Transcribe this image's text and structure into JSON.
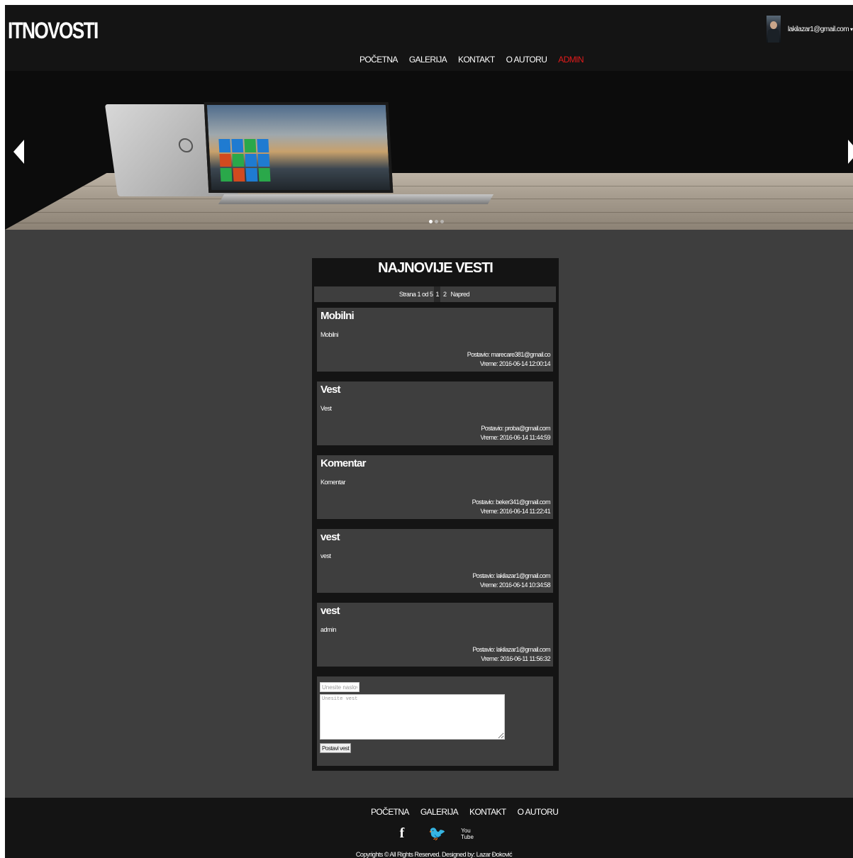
{
  "header": {
    "logo": "ITNOVOSTI",
    "user_email": "lakilazar1@gmail.com",
    "user_caret": "▾",
    "nav": [
      {
        "label": "POČETNA"
      },
      {
        "label": "GALERIJA"
      },
      {
        "label": "KONTAKT"
      },
      {
        "label": "O AUTORU"
      },
      {
        "label": "ADMIN"
      }
    ]
  },
  "slider": {
    "active_slide": 1,
    "slide_count": 3
  },
  "news": {
    "title": "NAJNOVIJE VESTI",
    "pager": {
      "text": "Strana 1 od 5",
      "pages": [
        "1",
        "2"
      ],
      "next": "Napred"
    },
    "articles": [
      {
        "title": "Mobilni",
        "body": "Mobilni",
        "author": "Postavio: marecare381@gmail.co",
        "time": "Vreme: 2016-06-14 12:00:14"
      },
      {
        "title": "Vest",
        "body": "Vest",
        "author": "Postavio: proba@gmail.com",
        "time": "Vreme: 2016-06-14 11:44:59"
      },
      {
        "title": "Komentar",
        "body": "Komentar",
        "author": "Postavio: beker341@gmail.com",
        "time": "Vreme: 2016-06-14 11:22:41"
      },
      {
        "title": "vest",
        "body": "vest",
        "author": "Postavio: lakilazar1@gmail.com",
        "time": "Vreme: 2016-06-14 10:34:58"
      },
      {
        "title": "vest",
        "body": "admin",
        "author": "Postavio: lakilazar1@gmail.com",
        "time": "Vreme: 2016-06-11 11:56:32"
      }
    ],
    "form": {
      "title_placeholder": "Unesite naslov vesti",
      "body_placeholder": "Unesite vest",
      "submit_label": "Postavi vest"
    }
  },
  "footer": {
    "nav": [
      {
        "label": "POČETNA"
      },
      {
        "label": "GALERIJA"
      },
      {
        "label": "KONTAKT"
      },
      {
        "label": "O AUTORU"
      }
    ],
    "social": {
      "facebook": "f",
      "twitter": "🐦",
      "youtube_top": "You",
      "youtube_bottom": "Tube"
    },
    "copyright": "Copyrights © All Rights Reserved. Designed by: Lazar Đoković"
  },
  "colors": {
    "background": "#3e3e3e",
    "bar": "#141414",
    "admin_accent": "#e21b1b"
  },
  "icons": [
    "avatar",
    "arrow-left-icon",
    "arrow-right-icon",
    "facebook-icon",
    "twitter-icon",
    "youtube-icon"
  ]
}
